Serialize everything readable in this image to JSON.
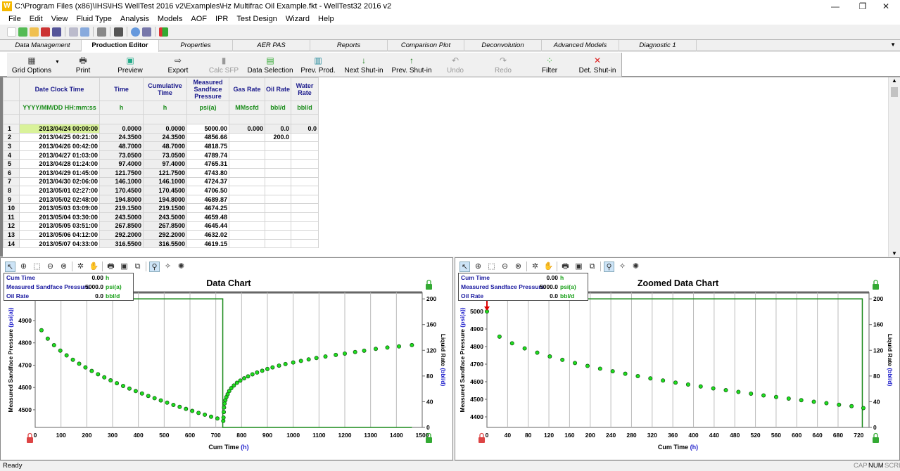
{
  "window": {
    "title": "C:\\Program Files (x86)\\IHS\\IHS WellTest 2016 v2\\Examples\\Hz Multifrac Oil Example.fkt - WellTest32 2016 v2",
    "minimize": "—",
    "maximize": "❐",
    "close": "✕",
    "logo": "W"
  },
  "menu": [
    "File",
    "Edit",
    "View",
    "Fluid Type",
    "Analysis",
    "Models",
    "AOF",
    "IPR",
    "Test Design",
    "Wizard",
    "Help"
  ],
  "tabs": [
    {
      "label": "Data Management"
    },
    {
      "label": "Production Editor",
      "active": true
    },
    {
      "label": "Properties"
    },
    {
      "label": "AER PAS"
    },
    {
      "label": "Reports"
    },
    {
      "label": "Comparison Plot"
    },
    {
      "label": "Deconvolution"
    },
    {
      "label": "Advanced Models"
    },
    {
      "label": "Diagnostic 1"
    }
  ],
  "ribbon": [
    {
      "label": "Grid Options",
      "icon": "▦"
    },
    {
      "label": "Print",
      "icon": "🖶"
    },
    {
      "label": "Preview",
      "icon": "▣"
    },
    {
      "label": "Export",
      "icon": "⇨"
    },
    {
      "label": "Calc SFP",
      "icon": "▮",
      "disabled": true
    },
    {
      "label": "Data Selection",
      "icon": "▤"
    },
    {
      "label": "Prev. Prod.",
      "icon": "▥"
    },
    {
      "label": "Next Shut-in",
      "icon": "↓"
    },
    {
      "label": "Prev. Shut-in",
      "icon": "↑"
    },
    {
      "label": "Undo",
      "icon": "↶",
      "disabled": true
    },
    {
      "label": "Redo",
      "icon": "↷",
      "disabled": true
    },
    {
      "label": "Filter",
      "icon": "⁘"
    },
    {
      "label": "Det. Shut-in",
      "icon": "✕"
    }
  ],
  "grid": {
    "headers": [
      "Date Clock Time",
      "Time",
      "Cumulative Time",
      "Measured Sandface Pressure",
      "Gas Rate",
      "Oil Rate",
      "Water Rate"
    ],
    "units": [
      "YYYY/MM/DD HH:mm:ss",
      "h",
      "h",
      "psi(a)",
      "MMscfd",
      "bbl/d",
      "bbl/d"
    ],
    "rows": [
      [
        "1",
        "2013/04/24 00:00:00",
        "0.0000",
        "0.0000",
        "5000.00",
        "0.000",
        "0.0",
        "0.0"
      ],
      [
        "2",
        "2013/04/25 00:21:00",
        "24.3500",
        "24.3500",
        "4856.66",
        "",
        "200.0",
        ""
      ],
      [
        "3",
        "2013/04/26 00:42:00",
        "48.7000",
        "48.7000",
        "4818.75",
        "",
        "",
        ""
      ],
      [
        "4",
        "2013/04/27 01:03:00",
        "73.0500",
        "73.0500",
        "4789.74",
        "",
        "",
        ""
      ],
      [
        "5",
        "2013/04/28 01:24:00",
        "97.4000",
        "97.4000",
        "4765.31",
        "",
        "",
        ""
      ],
      [
        "6",
        "2013/04/29 01:45:00",
        "121.7500",
        "121.7500",
        "4743.80",
        "",
        "",
        ""
      ],
      [
        "7",
        "2013/04/30 02:06:00",
        "146.1000",
        "146.1000",
        "4724.37",
        "",
        "",
        ""
      ],
      [
        "8",
        "2013/05/01 02:27:00",
        "170.4500",
        "170.4500",
        "4706.50",
        "",
        "",
        ""
      ],
      [
        "9",
        "2013/05/02 02:48:00",
        "194.8000",
        "194.8000",
        "4689.87",
        "",
        "",
        ""
      ],
      [
        "10",
        "2013/05/03 03:09:00",
        "219.1500",
        "219.1500",
        "4674.25",
        "",
        "",
        ""
      ],
      [
        "11",
        "2013/05/04 03:30:00",
        "243.5000",
        "243.5000",
        "4659.48",
        "",
        "",
        ""
      ],
      [
        "12",
        "2013/05/05 03:51:00",
        "267.8500",
        "267.8500",
        "4645.44",
        "",
        "",
        ""
      ],
      [
        "13",
        "2013/05/06 04:12:00",
        "292.2000",
        "292.2000",
        "4632.02",
        "",
        "",
        ""
      ],
      [
        "14",
        "2013/05/07 04:33:00",
        "316.5500",
        "316.5500",
        "4619.15",
        "",
        "",
        ""
      ]
    ]
  },
  "readout": {
    "rows": [
      {
        "label": "Cum Time",
        "value": "0.00",
        "unit": "h"
      },
      {
        "label": "Measured Sandface Pressure",
        "value": "5000.0",
        "unit": "psi(a)"
      },
      {
        "label": "Oil Rate",
        "value": "0.0",
        "unit": "bbl/d"
      }
    ]
  },
  "chart_data": [
    {
      "type": "scatter",
      "title": "Data Chart",
      "xlabel": "Cum Time",
      "xunit": "(h)",
      "ylabel": "Measured Sandface Pressure",
      "yunit": "(psi(a))",
      "y2label": "Liquid Rate",
      "y2unit": "(bbl/d)",
      "xlim": [
        0,
        1500
      ],
      "ylim": [
        4421,
        5026
      ],
      "y2lim": [
        0,
        210
      ],
      "xticks": [
        0,
        100,
        200,
        300,
        400,
        500,
        600,
        700,
        800,
        900,
        1000,
        1100,
        1200,
        1300,
        1400,
        1500
      ],
      "yticks": [
        4500,
        4600,
        4700,
        4800,
        4900
      ],
      "y2ticks": [
        0,
        40,
        80,
        120,
        160,
        200
      ],
      "pressure": [
        [
          24.35,
          4856.66
        ],
        [
          48.7,
          4818.75
        ],
        [
          73.05,
          4789.74
        ],
        [
          97.4,
          4765.31
        ],
        [
          121.75,
          4743.8
        ],
        [
          146.1,
          4724.37
        ],
        [
          170.45,
          4706.5
        ],
        [
          194.8,
          4689.87
        ],
        [
          219.15,
          4674.25
        ],
        [
          243.5,
          4659.48
        ],
        [
          267.85,
          4645.44
        ],
        [
          292.2,
          4632.02
        ],
        [
          316.55,
          4619.15
        ],
        [
          340.9,
          4607
        ],
        [
          365.25,
          4595
        ],
        [
          389.6,
          4584
        ],
        [
          413.95,
          4573
        ],
        [
          438.3,
          4562
        ],
        [
          462.65,
          4552
        ],
        [
          487,
          4542
        ],
        [
          511.35,
          4532
        ],
        [
          535.7,
          4522
        ],
        [
          560.05,
          4513
        ],
        [
          584.4,
          4504
        ],
        [
          608.75,
          4495
        ],
        [
          633.1,
          4486
        ],
        [
          657.45,
          4478
        ],
        [
          681.8,
          4469
        ],
        [
          706.15,
          4461
        ],
        [
          729,
          4450
        ],
        [
          730,
          4465
        ],
        [
          731,
          4490
        ],
        [
          732,
          4510
        ],
        [
          734,
          4528
        ],
        [
          737,
          4543
        ],
        [
          741,
          4557
        ],
        [
          746,
          4570
        ],
        [
          752,
          4584
        ],
        [
          760,
          4597
        ],
        [
          770,
          4609
        ],
        [
          782,
          4621
        ],
        [
          795,
          4631
        ],
        [
          810,
          4641
        ],
        [
          825,
          4650
        ],
        [
          842,
          4659
        ],
        [
          860,
          4667
        ],
        [
          880,
          4675
        ],
        [
          900,
          4683
        ],
        [
          920,
          4690
        ],
        [
          945,
          4698
        ],
        [
          970,
          4705
        ],
        [
          1000,
          4712
        ],
        [
          1030,
          4719
        ],
        [
          1060,
          4726
        ],
        [
          1090,
          4732
        ],
        [
          1125,
          4739
        ],
        [
          1165,
          4746
        ],
        [
          1200,
          4752
        ],
        [
          1240,
          4759
        ],
        [
          1275,
          4765
        ],
        [
          1320,
          4773
        ],
        [
          1365,
          4779
        ],
        [
          1410,
          4784
        ],
        [
          1460,
          4790
        ]
      ],
      "rate": [
        [
          0,
          200
        ],
        [
          727,
          200
        ],
        [
          727,
          0
        ],
        [
          1460,
          0
        ]
      ]
    },
    {
      "type": "scatter",
      "title": "Zoomed Data Chart",
      "xlabel": "Cum Time",
      "xunit": "(h)",
      "ylabel": "Measured Sandface Pressure",
      "yunit": "(psi(a))",
      "y2label": "Liquid Rate",
      "y2unit": "(bbl/d)",
      "xlim": [
        0,
        740
      ],
      "ylim": [
        4340,
        5108
      ],
      "y2lim": [
        0,
        210
      ],
      "xticks": [
        0,
        40,
        80,
        120,
        160,
        200,
        240,
        280,
        320,
        360,
        400,
        440,
        480,
        520,
        560,
        600,
        640,
        680,
        720
      ],
      "yticks": [
        4400,
        4500,
        4600,
        4700,
        4800,
        4900,
        5000
      ],
      "y2ticks": [
        0,
        40,
        80,
        120,
        160,
        200
      ],
      "pressure": [
        [
          0,
          5000
        ],
        [
          24.35,
          4856.66
        ],
        [
          48.7,
          4818.75
        ],
        [
          73.05,
          4789.74
        ],
        [
          97.4,
          4765.31
        ],
        [
          121.75,
          4743.8
        ],
        [
          146.1,
          4724.37
        ],
        [
          170.45,
          4706.5
        ],
        [
          194.8,
          4689.87
        ],
        [
          219.15,
          4674.25
        ],
        [
          243.5,
          4659.48
        ],
        [
          267.85,
          4645.44
        ],
        [
          292.2,
          4632.02
        ],
        [
          316.55,
          4619.15
        ],
        [
          340.9,
          4607
        ],
        [
          365.25,
          4595
        ],
        [
          389.6,
          4584
        ],
        [
          413.95,
          4573
        ],
        [
          438.3,
          4562
        ],
        [
          462.65,
          4552
        ],
        [
          487,
          4542
        ],
        [
          511.35,
          4532
        ],
        [
          535.7,
          4522
        ],
        [
          560.05,
          4513
        ],
        [
          584.4,
          4504
        ],
        [
          608.75,
          4495
        ],
        [
          633.1,
          4486
        ],
        [
          657.45,
          4478
        ],
        [
          681.8,
          4469
        ],
        [
          706.15,
          4461
        ],
        [
          729,
          4450
        ]
      ],
      "rate": [
        [
          0,
          200
        ],
        [
          727,
          200
        ],
        [
          727,
          0
        ]
      ],
      "marker": [
        0,
        5000
      ]
    }
  ],
  "status": {
    "text": "Ready",
    "cap": "CAP",
    "num": "NUM",
    "scrl": "SCRL"
  }
}
